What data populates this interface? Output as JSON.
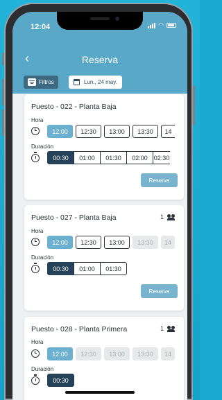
{
  "status": {
    "time": "12:04"
  },
  "header": {
    "title": "Reserva"
  },
  "toolbar": {
    "filter_label": "Filtros",
    "date_label": "Lun., 24 may."
  },
  "cards": [
    {
      "title": "Puesto - 022 - Planta Baja",
      "count": "",
      "hora_label": "Hora",
      "duracion_label": "Duración",
      "reserve_label": "Reserva",
      "times": [
        {
          "t": "12:00",
          "state": "selected"
        },
        {
          "t": "12:30",
          "state": "enabled"
        },
        {
          "t": "13:00",
          "state": "enabled"
        },
        {
          "t": "13:30",
          "state": "enabled"
        },
        {
          "t": "14",
          "state": "enabled"
        }
      ],
      "durations": [
        {
          "d": "00:30",
          "state": "selected"
        },
        {
          "d": "01:00",
          "state": "enabled"
        },
        {
          "d": "01:30",
          "state": "enabled"
        },
        {
          "d": "02:00",
          "state": "enabled"
        },
        {
          "d": "02:30",
          "state": "enabled"
        }
      ]
    },
    {
      "title": "Puesto - 027 - Planta Baja",
      "count": "1",
      "hora_label": "Hora",
      "duracion_label": "Duración",
      "reserve_label": "Reserva",
      "times": [
        {
          "t": "12:00",
          "state": "selected"
        },
        {
          "t": "12:30",
          "state": "enabled"
        },
        {
          "t": "13:00",
          "state": "enabled"
        },
        {
          "t": "13:30",
          "state": "disabled"
        },
        {
          "t": "14",
          "state": "disabled"
        }
      ],
      "durations": [
        {
          "d": "00:30",
          "state": "selected"
        },
        {
          "d": "01:00",
          "state": "enabled"
        },
        {
          "d": "01:30",
          "state": "enabled"
        }
      ]
    },
    {
      "title": "Puesto - 028 - Planta Primera",
      "count": "1",
      "hora_label": "Hora",
      "duracion_label": "Duración",
      "times": [
        {
          "t": "12:00",
          "state": "selected"
        },
        {
          "t": "12:30",
          "state": "disabled"
        },
        {
          "t": "13:00",
          "state": "disabled"
        },
        {
          "t": "13:30",
          "state": "disabled"
        },
        {
          "t": "14",
          "state": "disabled"
        }
      ],
      "durations": [
        {
          "d": "00:30",
          "state": "selected"
        }
      ]
    }
  ],
  "colors": {
    "header": "#5aa8c8",
    "selected_time": "#6bb0cf",
    "selected_duration": "#24435a",
    "reserve_button": "#78b4ce",
    "background": "#1aa9cf"
  },
  "icons": [
    "back-arrow-icon",
    "filter-icon",
    "calendar-icon",
    "clock-icon",
    "timer-icon",
    "people-icon",
    "signal-icon",
    "wifi-icon",
    "battery-icon"
  ]
}
